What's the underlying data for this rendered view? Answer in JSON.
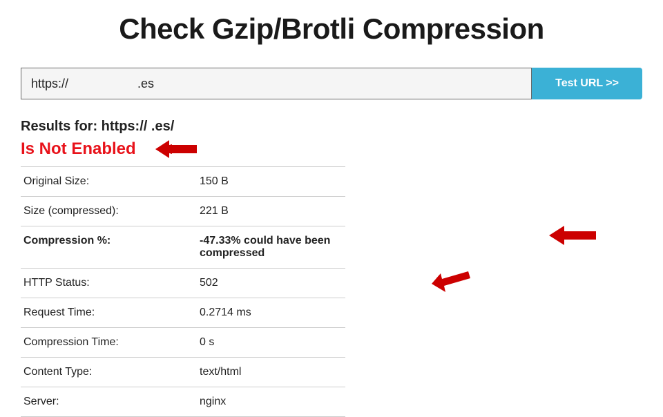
{
  "title": "Check Gzip/Brotli Compression",
  "form": {
    "url_value": "https://                    .es",
    "button_label": "Test URL >>"
  },
  "results": {
    "heading": "Results for: https://                            .es/",
    "status": "Is Not Enabled",
    "rows": {
      "original_size": {
        "label": "Original Size:",
        "value": "150 B"
      },
      "compressed_size": {
        "label": "Size (compressed):",
        "value": "221 B"
      },
      "compression_pct": {
        "label": "Compression %:",
        "value": "-47.33% could have been compressed"
      },
      "http_status": {
        "label": "HTTP Status:",
        "value": "502"
      },
      "request_time": {
        "label": "Request Time:",
        "value": "0.2714 ms"
      },
      "compression_time": {
        "label": "Compression Time:",
        "value": "0 s"
      },
      "content_type": {
        "label": "Content Type:",
        "value": "text/html"
      },
      "server": {
        "label": "Server:",
        "value": "nginx"
      }
    }
  }
}
